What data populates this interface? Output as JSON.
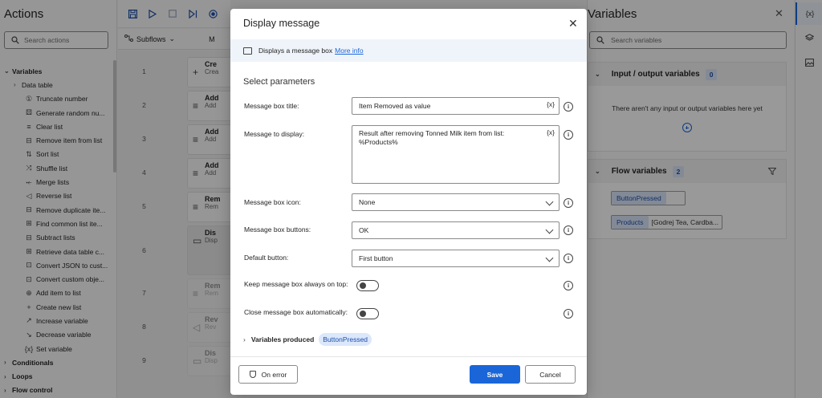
{
  "actions_pane": {
    "title": "Actions",
    "search_placeholder": "Search actions",
    "tree": [
      {
        "kind": "cat",
        "chev": "⌄",
        "label": "Variables"
      },
      {
        "kind": "sub",
        "chev": "›",
        "label": "Data table"
      },
      {
        "kind": "leaf",
        "icon": "number-icon",
        "glyph": "①",
        "label": "Truncate number"
      },
      {
        "kind": "leaf",
        "icon": "random-icon",
        "glyph": "⚄",
        "label": "Generate random nu..."
      },
      {
        "kind": "leaf",
        "icon": "clear-list-icon",
        "glyph": "≡",
        "label": "Clear list"
      },
      {
        "kind": "leaf",
        "icon": "remove-item-icon",
        "glyph": "⊟",
        "label": "Remove item from list"
      },
      {
        "kind": "leaf",
        "icon": "sort-icon",
        "glyph": "⇅",
        "label": "Sort list"
      },
      {
        "kind": "leaf",
        "icon": "shuffle-icon",
        "glyph": "⤨",
        "label": "Shuffle list"
      },
      {
        "kind": "leaf",
        "icon": "merge-icon",
        "glyph": "⤝",
        "label": "Merge lists"
      },
      {
        "kind": "leaf",
        "icon": "reverse-icon",
        "glyph": "◁",
        "label": "Reverse list"
      },
      {
        "kind": "leaf",
        "icon": "remove-duplicate-icon",
        "glyph": "⊟",
        "label": "Remove duplicate ite..."
      },
      {
        "kind": "leaf",
        "icon": "find-common-icon",
        "glyph": "⊞",
        "label": "Find common list ite..."
      },
      {
        "kind": "leaf",
        "icon": "subtract-icon",
        "glyph": "⊟",
        "label": "Subtract lists"
      },
      {
        "kind": "leaf",
        "icon": "retrieve-icon",
        "glyph": "⊞",
        "label": "Retrieve data table c..."
      },
      {
        "kind": "leaf",
        "icon": "json-icon",
        "glyph": "⊡",
        "label": "Convert JSON to cust..."
      },
      {
        "kind": "leaf",
        "icon": "convert-icon",
        "glyph": "⊡",
        "label": "Convert custom obje..."
      },
      {
        "kind": "leaf",
        "icon": "add-item-icon",
        "glyph": "⊕",
        "label": "Add item to list"
      },
      {
        "kind": "leaf",
        "icon": "plus-icon",
        "glyph": "+",
        "label": "Create new list"
      },
      {
        "kind": "leaf",
        "icon": "increase-icon",
        "glyph": "↗",
        "label": "Increase variable"
      },
      {
        "kind": "leaf",
        "icon": "decrease-icon",
        "glyph": "↘",
        "label": "Decrease variable"
      },
      {
        "kind": "leaf",
        "icon": "set-variable-icon",
        "glyph": "{x}",
        "label": "Set variable"
      },
      {
        "kind": "cat",
        "chev": "›",
        "label": "Conditionals"
      },
      {
        "kind": "cat",
        "chev": "›",
        "label": "Loops"
      },
      {
        "kind": "cat",
        "chev": "›",
        "label": "Flow control"
      }
    ]
  },
  "toolbar": {
    "subflows_label": "Subflows",
    "main_tab_label": "M"
  },
  "flow_steps": [
    {
      "num": "1",
      "title": "Cre",
      "desc": "Crea",
      "glyph": "+",
      "state": "normal"
    },
    {
      "num": "2",
      "title": "Add",
      "desc": "Add",
      "glyph": "≡",
      "state": "normal"
    },
    {
      "num": "3",
      "title": "Add",
      "desc": "Add",
      "glyph": "≡",
      "state": "normal"
    },
    {
      "num": "4",
      "title": "Add",
      "desc": "Add",
      "glyph": "≡",
      "state": "normal"
    },
    {
      "num": "5",
      "title": "Rem",
      "desc": "Rem",
      "glyph": "≡",
      "state": "normal"
    },
    {
      "num": "6",
      "title": "Dis",
      "desc": "Disp",
      "glyph": "▭",
      "state": "selected"
    },
    {
      "num": "7",
      "title": "Rem",
      "desc": "Rem",
      "glyph": "≡",
      "state": "dim"
    },
    {
      "num": "8",
      "title": "Rev",
      "desc": "Rev",
      "glyph": "◁",
      "state": "dim"
    },
    {
      "num": "9",
      "title": "Dis",
      "desc": "Disp",
      "glyph": "▭",
      "state": "dim"
    }
  ],
  "variables_pane": {
    "title": "Variables",
    "search_placeholder": "Search variables",
    "io_section": {
      "label": "Input / output variables",
      "count": "0",
      "empty_text": "There aren't any input or output variables here yet"
    },
    "flow_section": {
      "label": "Flow variables",
      "count": "2"
    },
    "flow_variables": [
      {
        "name": "ButtonPressed",
        "value": ""
      },
      {
        "name": "Products",
        "value": "[Godrej Tea, Cardba..."
      }
    ]
  },
  "rail": {
    "var_label": "{x}"
  },
  "dialog": {
    "title": "Display message",
    "banner_text": "Displays a message box",
    "more_info_link": "More info",
    "section_title": "Select parameters",
    "fields": {
      "title_label": "Message box title:",
      "title_value": "Item Removed as value",
      "message_label": "Message to display:",
      "message_value": "Result after removing Tonned Milk item from list:\n%Products%",
      "icon_label": "Message box icon:",
      "icon_value": "None",
      "buttons_label": "Message box buttons:",
      "buttons_value": "OK",
      "default_label": "Default button:",
      "default_value": "First button",
      "ontop_label": "Keep message box always on top:",
      "autoclose_label": "Close message box automatically:"
    },
    "fx_label": "{x}",
    "variables_produced_label": "Variables produced",
    "variables_produced_chip": "ButtonPressed",
    "on_error_label": "On error",
    "save_label": "Save",
    "cancel_label": "Cancel"
  },
  "colors": {
    "accent": "#1a66d9",
    "overlay": "rgba(0,0,0,0.4)",
    "chip_bg": "#dbe7fb"
  }
}
